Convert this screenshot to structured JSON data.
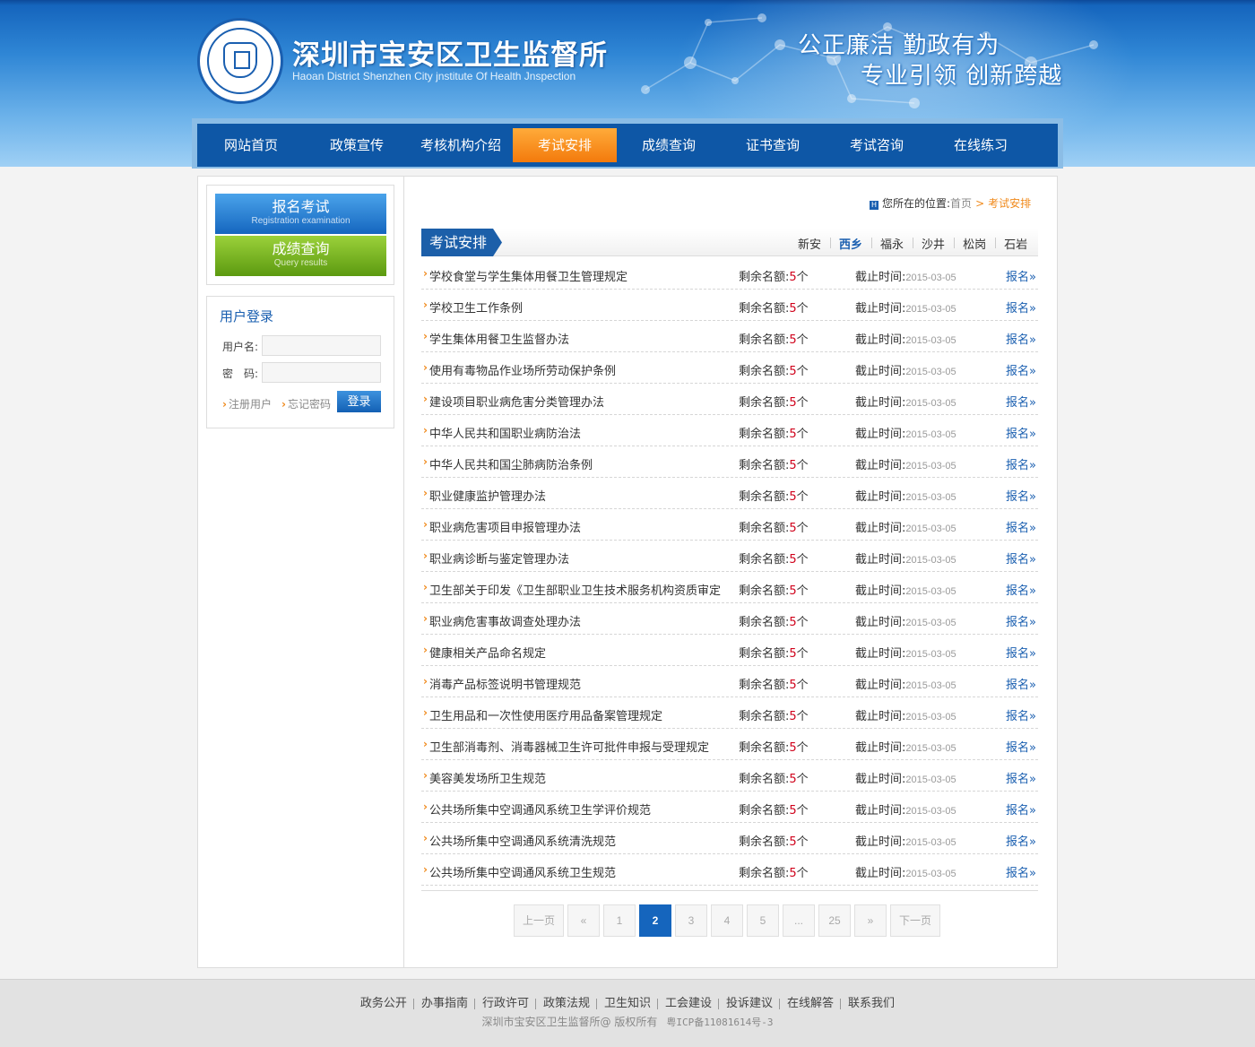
{
  "header": {
    "site_title": "深圳市宝安区卫生监督所",
    "site_subtitle": "Haoan District Shenzhen City jnstitute Of Health Jnspection",
    "slogan_line1": "公正廉洁 勤政有为",
    "slogan_line2": "专业引领 创新跨越"
  },
  "nav": {
    "items": [
      {
        "label": "网站首页"
      },
      {
        "label": "政策宣传"
      },
      {
        "label": "考核机构介绍"
      },
      {
        "label": "考试安排"
      },
      {
        "label": "成绩查询"
      },
      {
        "label": "证书查询"
      },
      {
        "label": "考试咨询"
      },
      {
        "label": "在线练习"
      }
    ],
    "active_index": 3
  },
  "sidebar": {
    "register": {
      "cn": "报名考试",
      "en": "Registration examination"
    },
    "score": {
      "cn": "成绩查询",
      "en": "Query results"
    },
    "login": {
      "title": "用户登录",
      "username_label": "用户名:",
      "password_label": "密　码:",
      "username_value": "",
      "password_value": "",
      "register_link": "注册用户",
      "forgot_link": "忘记密码",
      "login_button": "登录"
    }
  },
  "breadcrumb": {
    "icon": "H",
    "prefix": "您所在的位置:",
    "home": "首页",
    "separator": ">",
    "current": "考试安排"
  },
  "section": {
    "title": "考试安排",
    "tabs": [
      "新安",
      "西乡",
      "福永",
      "沙井",
      "松岗",
      "石岩"
    ],
    "active_tab": 1
  },
  "list": {
    "remain_label": "剩余名额:",
    "remain_unit": "个",
    "deadline_label": "截止时间:",
    "signup_label": "报名»",
    "rows": [
      {
        "title": "学校食堂与学生集体用餐卫生管理规定",
        "remain": "5",
        "deadline": "2015-03-05"
      },
      {
        "title": "学校卫生工作条例",
        "remain": "5",
        "deadline": "2015-03-05"
      },
      {
        "title": "学生集体用餐卫生监督办法",
        "remain": "5",
        "deadline": "2015-03-05"
      },
      {
        "title": "使用有毒物品作业场所劳动保护条例",
        "remain": "5",
        "deadline": "2015-03-05"
      },
      {
        "title": "建设项目职业病危害分类管理办法",
        "remain": "5",
        "deadline": "2015-03-05"
      },
      {
        "title": "中华人民共和国职业病防治法",
        "remain": "5",
        "deadline": "2015-03-05"
      },
      {
        "title": "中华人民共和国尘肺病防治条例",
        "remain": "5",
        "deadline": "2015-03-05"
      },
      {
        "title": "职业健康监护管理办法",
        "remain": "5",
        "deadline": "2015-03-05"
      },
      {
        "title": "职业病危害项目申报管理办法",
        "remain": "5",
        "deadline": "2015-03-05"
      },
      {
        "title": "职业病诊断与鉴定管理办法",
        "remain": "5",
        "deadline": "2015-03-05"
      },
      {
        "title": "卫生部关于印发《卫生部职业卫生技术服务机构资质审定",
        "remain": "5",
        "deadline": "2015-03-05"
      },
      {
        "title": "职业病危害事故调查处理办法",
        "remain": "5",
        "deadline": "2015-03-05"
      },
      {
        "title": "健康相关产品命名规定",
        "remain": "5",
        "deadline": "2015-03-05"
      },
      {
        "title": "消毒产品标签说明书管理规范",
        "remain": "5",
        "deadline": "2015-03-05"
      },
      {
        "title": "卫生用品和一次性使用医疗用品备案管理规定",
        "remain": "5",
        "deadline": "2015-03-05"
      },
      {
        "title": "卫生部消毒剂、消毒器械卫生许可批件申报与受理规定",
        "remain": "5",
        "deadline": "2015-03-05"
      },
      {
        "title": "美容美发场所卫生规范",
        "remain": "5",
        "deadline": "2015-03-05"
      },
      {
        "title": "公共场所集中空调通风系统卫生学评价规范",
        "remain": "5",
        "deadline": "2015-03-05"
      },
      {
        "title": "公共场所集中空调通风系统清洗规范",
        "remain": "5",
        "deadline": "2015-03-05"
      },
      {
        "title": "公共场所集中空调通风系统卫生规范",
        "remain": "5",
        "deadline": "2015-03-05"
      }
    ]
  },
  "pager": {
    "prev": "上一页",
    "first": "«",
    "pages": [
      "1",
      "2",
      "3",
      "4",
      "5",
      "...",
      "25"
    ],
    "active": "2",
    "last": "»",
    "next": "下一页"
  },
  "footer": {
    "links": [
      "政务公开",
      "办事指南",
      "行政许可",
      "政策法规",
      "卫生知识",
      "工会建设",
      "投诉建议",
      "在线解答",
      "联系我们"
    ],
    "copyright": "深圳市宝安区卫生监督所@ 版权所有",
    "icp": "粤ICP备11081614号-3"
  },
  "colors": {
    "brand_blue": "#1565bd",
    "nav_active_orange": "#f37a0c",
    "register_green": "#5c9a10",
    "accent_red": "#d0021b"
  }
}
